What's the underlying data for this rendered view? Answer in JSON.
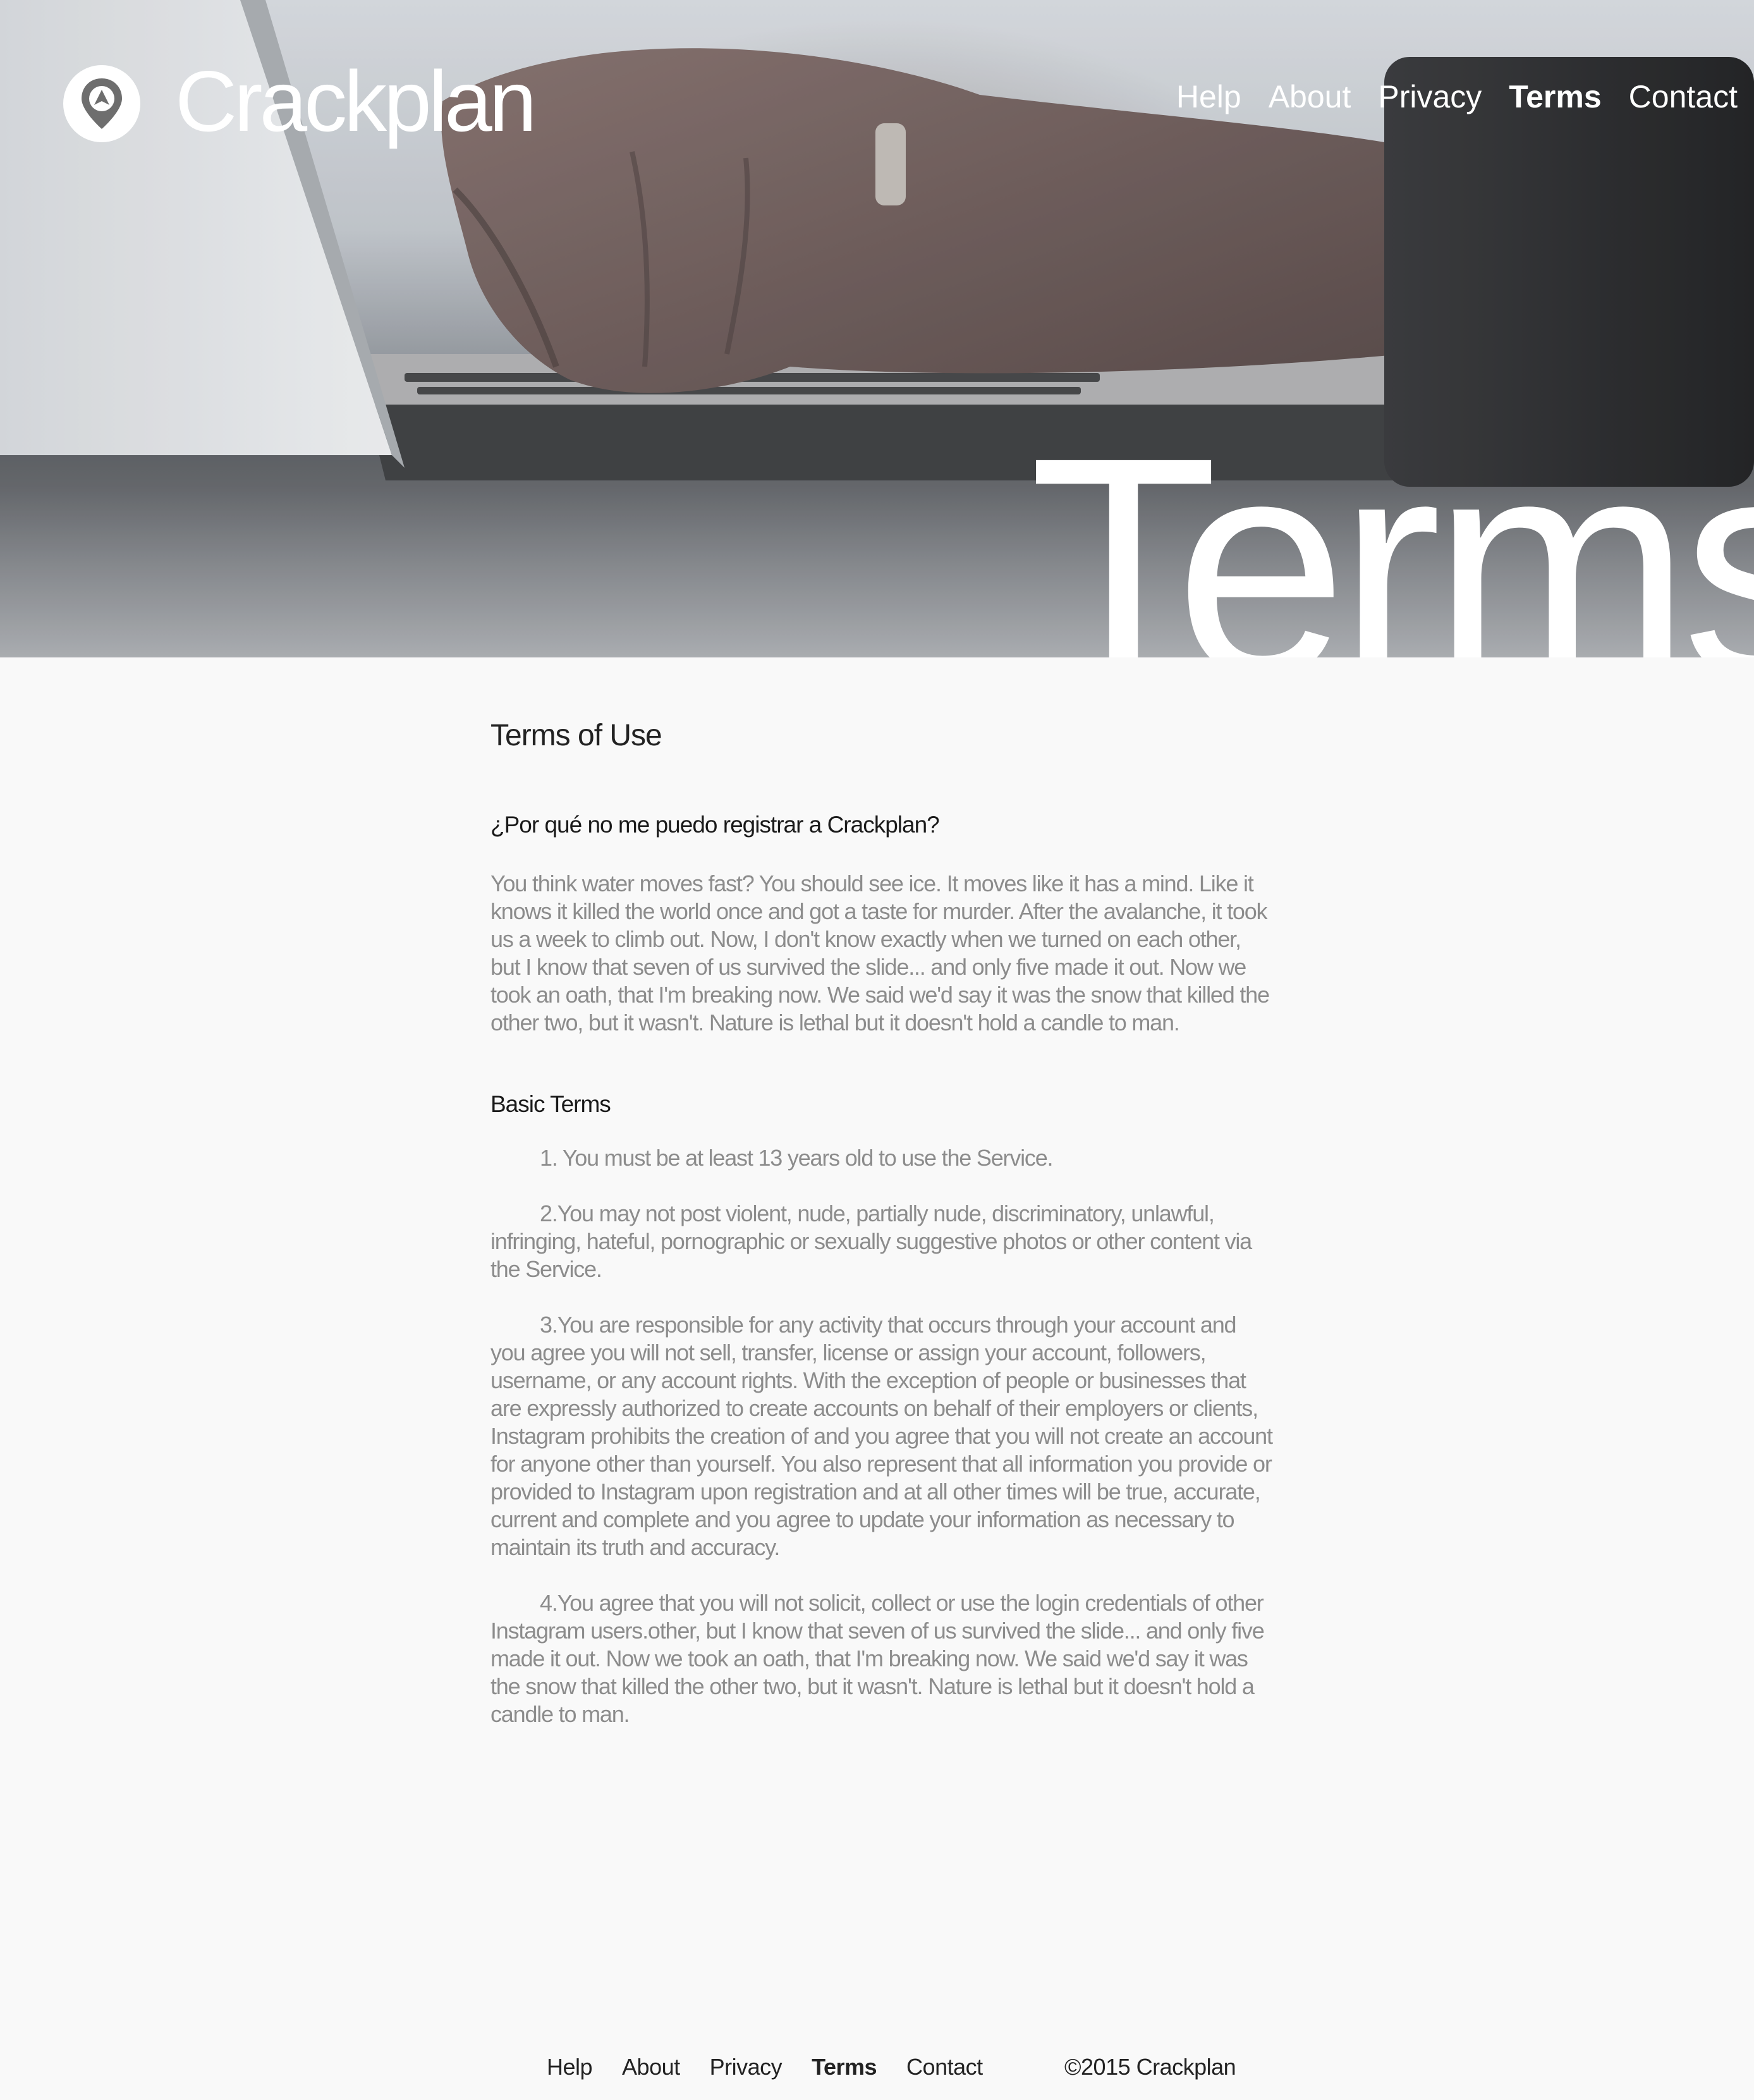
{
  "brand": {
    "name": "Crackplan",
    "logo_icon": "map-pin-icon"
  },
  "nav": {
    "items": [
      {
        "label": "Help",
        "active": false
      },
      {
        "label": "About",
        "active": false
      },
      {
        "label": "Privacy",
        "active": false
      },
      {
        "label": "Terms",
        "active": true
      },
      {
        "label": "Contact",
        "active": false
      }
    ]
  },
  "hero": {
    "title": "Terms"
  },
  "content": {
    "title": "Terms of Use",
    "question": "¿Por qué no me puedo registrar a Crackplan?",
    "intro": "You think water moves fast? You should see ice. It moves like it has a mind. Like it knows it killed the world once and got a taste for murder. After the avalanche, it took us a week to climb out. Now, I don't know exactly when we turned on each other, but I know that seven of us survived the slide... and only five made it out. Now we took an oath, that I'm breaking now. We said we'd say it was the snow that killed the other two, but it wasn't. Nature is lethal but it doesn't hold a candle to man.",
    "basic_terms_heading": "Basic Terms",
    "terms": [
      "1. You must be at least 13 years old to use the Service.",
      "2.You may not post violent, nude, partially nude, discriminatory, unlawful, infringing, hateful, pornographic or sexually suggestive photos or other content via the Service.",
      "3.You are responsible for any activity that occurs through your account and you agree you will not sell, transfer, license or assign your account, followers, username, or any account rights. With the exception of people or businesses that are expressly authorized to create accounts on behalf of their employers or clients, Instagram prohibits the creation of and you agree that you will not create an account for anyone other than yourself. You also represent that all information you provide or provided to Instagram upon registration and at all other times will be true, accurate, current and complete and you agree to update your information as necessary to maintain its truth and accuracy.",
      "4.You agree that you will not solicit, collect or use the login credentials of other Instagram users.other, but I know that seven of us survived the slide... and only five made it out. Now we took an oath, that I'm breaking now. We said we'd say it was the snow that killed the other two, but it wasn't. Nature is lethal but it doesn't hold a candle to man."
    ]
  },
  "footer": {
    "nav": [
      {
        "label": "Help",
        "active": false
      },
      {
        "label": "About",
        "active": false
      },
      {
        "label": "Privacy",
        "active": false
      },
      {
        "label": "Terms",
        "active": true
      },
      {
        "label": "Contact",
        "active": false
      }
    ],
    "copyright": "©2015 Crackplan"
  }
}
